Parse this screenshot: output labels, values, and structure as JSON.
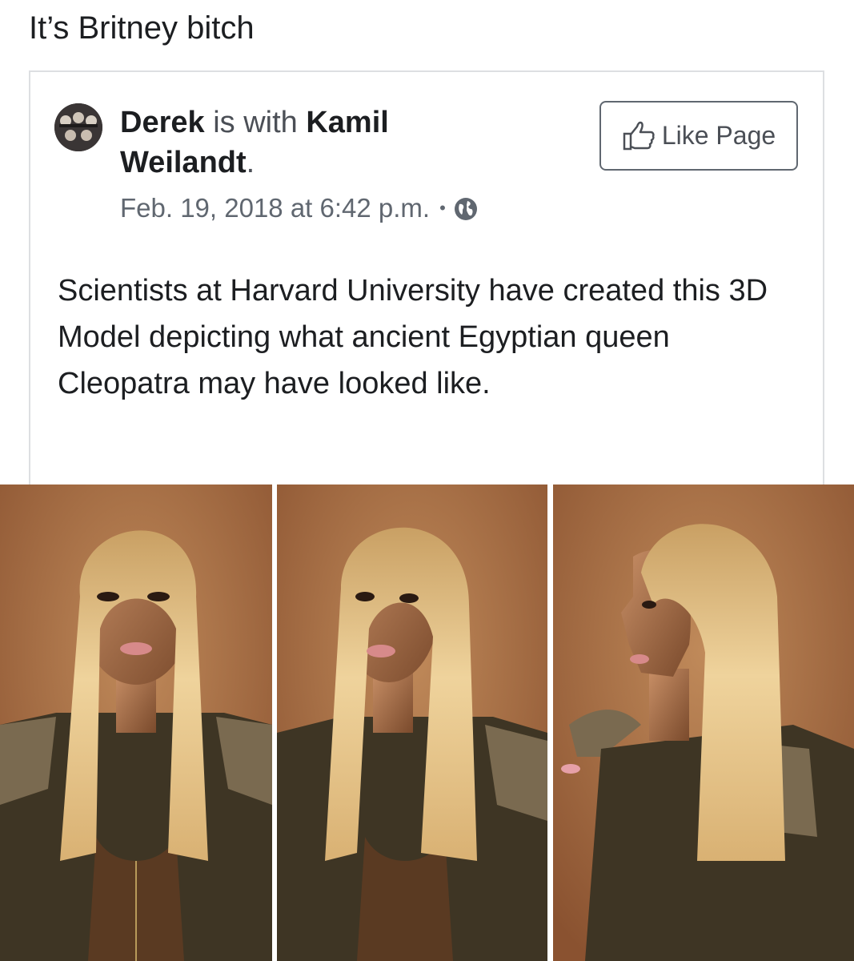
{
  "caption": "It’s Britney bitch",
  "post": {
    "author": "Derek",
    "connector": " is with ",
    "tagged": "Kamil Weilandt",
    "period": ".",
    "timestamp": "Feb. 19, 2018 at 6:42 p.m.",
    "dot": "•",
    "privacy_icon": "globe-icon",
    "like_page_label": "Like Page",
    "like_icon": "thumbs-up-icon",
    "text": "Scientists at Harvard University have created this 3D Model depicting what ancient Egyptian queen Cleopatra may have looked like."
  },
  "photos": [
    {
      "name": "front-view"
    },
    {
      "name": "three-quarter-view"
    },
    {
      "name": "side-profile-view"
    }
  ],
  "colors": {
    "background": "#ffffff",
    "card_border": "#dddfe2",
    "text_primary": "#1c1e21",
    "text_secondary": "#606770",
    "photo_background": "#a0643a",
    "hair": "#e0bd80",
    "suit": "#3a3020"
  }
}
